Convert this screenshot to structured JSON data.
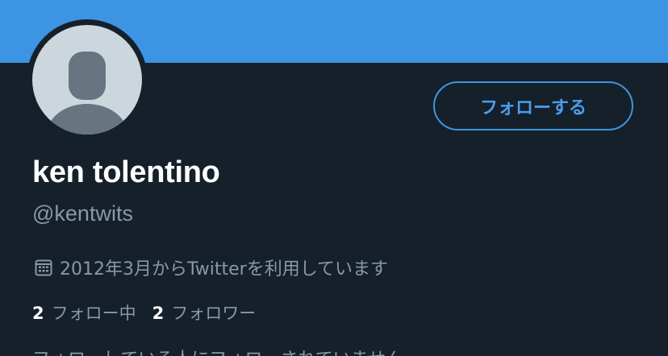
{
  "profile": {
    "display_name": "ken tolentino",
    "handle": "@kentwits",
    "joined": "2012年3月からTwitterを利用しています",
    "follow_button": "フォローする",
    "following_count": "2",
    "following_label": "フォロー中",
    "followers_count": "2",
    "followers_label": "フォロワー",
    "cutoff_text": "フォローしている人にフォローされていません"
  },
  "colors": {
    "banner": "#3d94e2",
    "background": "#15202b",
    "accent": "#4a9eea",
    "secondary_text": "#8899a6",
    "avatar_bg": "#ccd6dd",
    "avatar_figure": "#66757f"
  },
  "icons": {
    "avatar": "default-profile-icon",
    "joined": "calendar-icon"
  }
}
